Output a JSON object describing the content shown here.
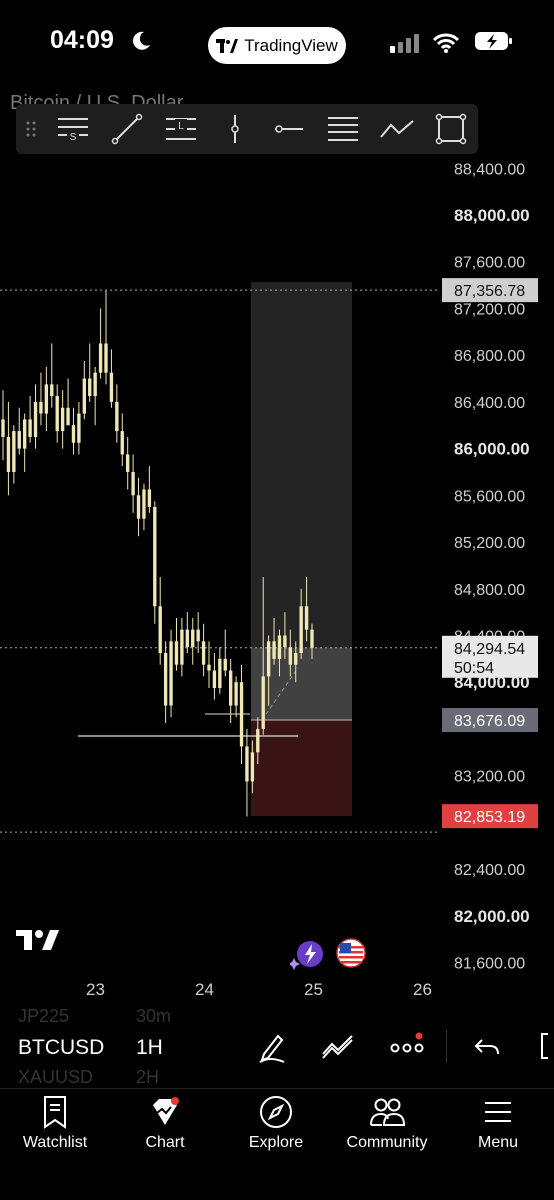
{
  "status_bar": {
    "time": "04:09",
    "app_pill": "TradingView"
  },
  "header": {
    "symbol_title": "Bitcoin / U.S. Dollar"
  },
  "drawing_toolbar": {
    "tools": [
      "settings-icon",
      "trend-line-icon",
      "long-position-icon",
      "vertical-line-icon",
      "horizontal-ray-icon",
      "fib-retracement-icon",
      "path-icon",
      "rectangle-icon"
    ]
  },
  "chart_data": {
    "type": "candlestick",
    "price_axis": [
      "88,800.00",
      "88,400.00",
      "88,000.00",
      "87,600.00",
      "87,200.00",
      "86,800.00",
      "86,400.00",
      "86,000.00",
      "85,600.00",
      "85,200.00",
      "84,800.00",
      "84,400.00",
      "84,000.00",
      "83,200.00",
      "82,400.00",
      "82,000.00",
      "81,600.00"
    ],
    "bold_ticks": [
      "88,000.00",
      "86,000.00",
      "84,000.00",
      "82,000.00"
    ],
    "time_axis": [
      "23",
      "24",
      "25",
      "26"
    ],
    "price_tags": {
      "high_line": "87,356.78",
      "last_price": "84,294.54",
      "countdown": "50:54",
      "entry": "83,676.09",
      "stop": "82,853.19"
    },
    "colors": {
      "candle": "#efe7b4",
      "profit_zone": "#3a3a3a",
      "loss_zone": "#3a1414",
      "stop_tag": "#e04040",
      "entry_tag": "#6b6b77",
      "last_tag": "#e8e8e8",
      "high_tag": "#cfcfcf"
    },
    "candles": [
      [
        86250,
        86500,
        85900,
        86100
      ],
      [
        86100,
        86400,
        85600,
        85800
      ],
      [
        85800,
        86200,
        85700,
        86150
      ],
      [
        86150,
        86350,
        85950,
        86000
      ],
      [
        86000,
        86300,
        85800,
        86250
      ],
      [
        86250,
        86450,
        86050,
        86100
      ],
      [
        86100,
        86550,
        86000,
        86400
      ],
      [
        86400,
        86650,
        86200,
        86300
      ],
      [
        86300,
        86700,
        86150,
        86550
      ],
      [
        86550,
        86900,
        86350,
        86450
      ],
      [
        86450,
        86550,
        86050,
        86150
      ],
      [
        86150,
        86500,
        86000,
        86350
      ],
      [
        86350,
        86600,
        86200,
        86200
      ],
      [
        86200,
        86350,
        85950,
        86050
      ],
      [
        86050,
        86400,
        85950,
        86300
      ],
      [
        86300,
        86750,
        86250,
        86600
      ],
      [
        86600,
        86900,
        86400,
        86450
      ],
      [
        86450,
        86700,
        86200,
        86650
      ],
      [
        86650,
        87200,
        86600,
        86900
      ],
      [
        86900,
        87350,
        86550,
        86650
      ],
      [
        86650,
        86850,
        86350,
        86400
      ],
      [
        86400,
        86550,
        86050,
        86150
      ],
      [
        86150,
        86300,
        85850,
        85950
      ],
      [
        85950,
        86100,
        85650,
        85800
      ],
      [
        85800,
        85950,
        85450,
        85600
      ],
      [
        85600,
        85750,
        85250,
        85400
      ],
      [
        85400,
        85700,
        85300,
        85650
      ],
      [
        85650,
        85850,
        85450,
        85500
      ],
      [
        85500,
        85550,
        84500,
        84650
      ],
      [
        84650,
        84900,
        84150,
        84250
      ],
      [
        84250,
        84350,
        83650,
        83800
      ],
      [
        83800,
        84450,
        83700,
        84350
      ],
      [
        84350,
        84550,
        84100,
        84150
      ],
      [
        84150,
        84550,
        84050,
        84450
      ],
      [
        84450,
        84600,
        84250,
        84300
      ],
      [
        84300,
        84550,
        84150,
        84450
      ],
      [
        84450,
        84600,
        84250,
        84350
      ],
      [
        84350,
        84500,
        84050,
        84150
      ],
      [
        84150,
        84350,
        83950,
        84100
      ],
      [
        84100,
        84250,
        83850,
        83950
      ],
      [
        83950,
        84300,
        83900,
        84200
      ],
      [
        84200,
        84450,
        84050,
        84100
      ],
      [
        84100,
        84200,
        83650,
        83800
      ],
      [
        83800,
        84050,
        83700,
        84000
      ],
      [
        84000,
        84150,
        83300,
        83450
      ],
      [
        83450,
        83600,
        82850,
        83150
      ],
      [
        83150,
        83500,
        83050,
        83400
      ],
      [
        83400,
        83700,
        83300,
        83600
      ],
      [
        83600,
        84900,
        83550,
        84050
      ],
      [
        84050,
        84400,
        83800,
        84350
      ],
      [
        84350,
        84550,
        84150,
        84200
      ],
      [
        84200,
        84450,
        84050,
        84400
      ],
      [
        84400,
        84600,
        84200,
        84300
      ],
      [
        84300,
        84450,
        84050,
        84150
      ],
      [
        84150,
        84350,
        84000,
        84250
      ],
      [
        84250,
        84800,
        84200,
        84650
      ],
      [
        84650,
        84900,
        84350,
        84450
      ],
      [
        84450,
        84500,
        84200,
        84294
      ]
    ]
  },
  "badges": {
    "ai": "ai-badge-icon",
    "flag": "us-flag-icon"
  },
  "watchlist_peek": {
    "above_symbol": "JP225",
    "above_interval": "30m",
    "below_symbol": "XAUUSD",
    "below_interval": "2H"
  },
  "symbol_bar": {
    "symbol": "BTCUSD",
    "interval": "1H"
  },
  "tabs": [
    {
      "label": "Watchlist",
      "icon": "watchlist-icon"
    },
    {
      "label": "Chart",
      "icon": "chart-icon"
    },
    {
      "label": "Explore",
      "icon": "compass-icon"
    },
    {
      "label": "Community",
      "icon": "community-icon"
    },
    {
      "label": "Menu",
      "icon": "menu-icon"
    }
  ]
}
